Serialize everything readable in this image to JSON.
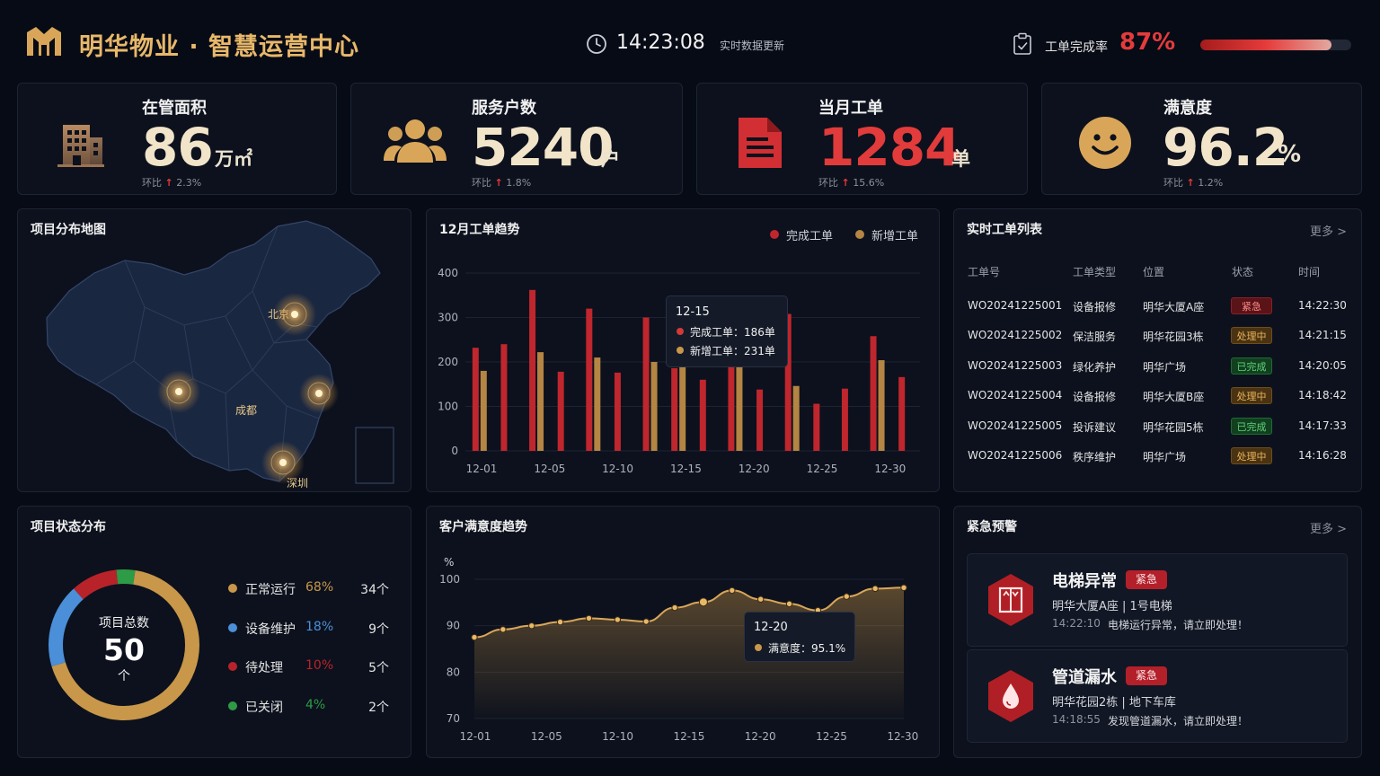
{
  "header": {
    "title": "明华物业 · 智慧运营中心",
    "time": "14:23:08",
    "time_note": "实时数据更新",
    "completion_label": "工单完成率",
    "completion_value": "87%",
    "completion_fraction": 0.87
  },
  "kpis": [
    {
      "label": "在管面积",
      "value": "86",
      "unit": "万㎡",
      "trend_label": "环比",
      "trend": "2.3%",
      "icon": "building-icon",
      "color": "#f1e4c9"
    },
    {
      "label": "服务户数",
      "value": "5240",
      "unit": "户",
      "trend_label": "环比",
      "trend": "1.8%",
      "icon": "users-icon",
      "color": "#f1e4c9"
    },
    {
      "label": "当月工单",
      "value": "1284",
      "unit": "单",
      "trend_label": "环比",
      "trend": "15.6%",
      "icon": "document-icon",
      "color": "#e23b3b"
    },
    {
      "label": "满意度",
      "value": "96.2",
      "unit": "%",
      "trend_label": "环比",
      "trend": "1.2%",
      "icon": "smile-icon",
      "color": "#f1e4c9"
    }
  ],
  "map": {
    "title": "项目分布地图",
    "cities": [
      {
        "name": "北京",
        "x": 298,
        "y": 350
      },
      {
        "name": "成都",
        "x": 262,
        "y": 457
      },
      {
        "name": "深圳",
        "x": 319,
        "y": 538
      }
    ]
  },
  "trend_chart": {
    "title": "12月工单趋势",
    "legend": [
      "完成工单",
      "新增工单"
    ],
    "tooltip": {
      "date": "12-15",
      "line1": "完成工单：186单",
      "line2": "新增工单：231单"
    }
  },
  "worklist": {
    "title": "实时工单列表",
    "more": "更多 >",
    "headers": [
      "工单号",
      "工单类型",
      "位置",
      "状态",
      "时间"
    ],
    "rows": [
      {
        "id": "WO20241225001",
        "type": "设备报修",
        "location": "明华大厦A座",
        "status": "紧急",
        "status_key": "urgent",
        "time": "14:22:30"
      },
      {
        "id": "WO20241225002",
        "type": "保洁服务",
        "location": "明华花园3栋",
        "status": "处理中",
        "status_key": "progress",
        "time": "14:21:15"
      },
      {
        "id": "WO20241225003",
        "type": "绿化养护",
        "location": "明华广场",
        "status": "已完成",
        "status_key": "done",
        "time": "14:20:05"
      },
      {
        "id": "WO20241225004",
        "type": "设备报修",
        "location": "明华大厦B座",
        "status": "处理中",
        "status_key": "progress",
        "time": "14:18:42"
      },
      {
        "id": "WO20241225005",
        "type": "投诉建议",
        "location": "明华花园5栋",
        "status": "已完成",
        "status_key": "done",
        "time": "14:17:33"
      },
      {
        "id": "WO20241225006",
        "type": "秩序维护",
        "location": "明华广场",
        "status": "处理中",
        "status_key": "progress",
        "time": "14:16:28"
      }
    ]
  },
  "status_dist": {
    "title": "项目状态分布",
    "center_label": "项目总数",
    "center_value": "50",
    "center_unit": "个",
    "items": [
      {
        "name": "正常运行",
        "pct": "68%",
        "count": "34个",
        "color": "#c8974a",
        "value": 68
      },
      {
        "name": "设备维护",
        "pct": "18%",
        "count": "9个",
        "color": "#4a8fd8",
        "value": 18
      },
      {
        "name": "待处理",
        "pct": "10%",
        "count": "5个",
        "color": "#b8232a",
        "value": 10
      },
      {
        "name": "已关闭",
        "pct": "4%",
        "count": "2个",
        "color": "#2e9b47",
        "value": 4
      }
    ]
  },
  "satisfaction": {
    "title": "客户满意度趋势",
    "unit": "%",
    "tooltip": {
      "date": "12-20",
      "text": "满意度：95.1%"
    }
  },
  "alerts": {
    "title": "紧急预警",
    "more": "更多 >",
    "items": [
      {
        "title": "电梯异常",
        "tag": "紧急",
        "location": "明华大厦A座 | 1号电梯",
        "time": "14:22:10",
        "message": "电梯运行异常，请立即处理！",
        "icon": "elevator-icon"
      },
      {
        "title": "管道漏水",
        "tag": "紧急",
        "location": "明华花园2栋 | 地下车库",
        "time": "14:18:55",
        "message": "发现管道漏水，请立即处理！",
        "icon": "water-drop-icon"
      }
    ]
  },
  "chart_data": [
    {
      "type": "bar",
      "title": "12月工单趋势",
      "ylim": [
        0,
        400
      ],
      "yticks": [
        0,
        100,
        200,
        300,
        400
      ],
      "x_tick_labels": [
        "12-01",
        "12-05",
        "12-10",
        "12-15",
        "12-20",
        "12-25",
        "12-30"
      ],
      "legend_placement": "top-right",
      "categories": [
        "12-01",
        "12-03",
        "12-05",
        "12-07",
        "12-09",
        "12-11",
        "12-13",
        "12-15",
        "12-17",
        "12-19",
        "12-21",
        "12-23",
        "12-25",
        "12-27",
        "12-29",
        "12-31"
      ],
      "series": [
        {
          "name": "完成工单",
          "color": "#c0262d",
          "values": [
            232,
            240,
            362,
            178,
            320,
            176,
            300,
            186,
            160,
            300,
            138,
            308,
            106,
            140,
            258,
            166
          ]
        },
        {
          "name": "新增工单",
          "color": "#b48543",
          "values": [
            180,
            0,
            222,
            0,
            210,
            0,
            200,
            231,
            0,
            190,
            0,
            146,
            0,
            0,
            204,
            0
          ]
        }
      ]
    },
    {
      "type": "area",
      "title": "客户满意度趋势",
      "ylabel": "%",
      "ylim": [
        70,
        100
      ],
      "yticks": [
        70,
        80,
        90,
        100
      ],
      "x_tick_labels": [
        "12-01",
        "12-05",
        "12-10",
        "12-15",
        "12-20",
        "12-25",
        "12-30"
      ],
      "x": [
        "12-01",
        "12-03",
        "12-05",
        "12-07",
        "12-09",
        "12-11",
        "12-13",
        "12-15",
        "12-17",
        "12-19",
        "12-21",
        "12-23",
        "12-25",
        "12-27",
        "12-29",
        "12-31"
      ],
      "values": [
        87.5,
        89.2,
        90.0,
        90.8,
        91.6,
        91.3,
        90.9,
        93.9,
        95.1,
        97.6,
        95.7,
        94.7,
        93.3,
        96.3,
        98.0,
        98.2
      ]
    }
  ]
}
